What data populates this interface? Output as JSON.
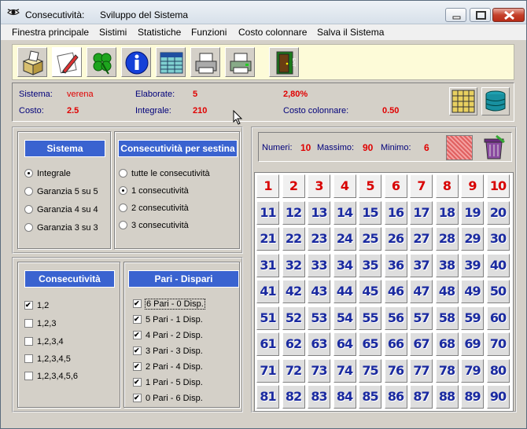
{
  "window": {
    "app_title": "Consecutività:",
    "doc_title": "Sviluppo del Sistema"
  },
  "menu": [
    "Finestra principale",
    "Sistimi",
    "Statistiche",
    "Funzioni",
    "Costo colonnare",
    "Salva il Sistema"
  ],
  "toolbar": [
    "open-box-icon",
    "edit-pen-icon",
    "clover-icon",
    "info-icon",
    "table-sheet-icon",
    "printer-icon",
    "printer-color-icon",
    "exit-door-icon"
  ],
  "info": {
    "sistema_label": "Sistema:",
    "sistema_value": "verena",
    "costo_label": "Costo:",
    "costo_value": "2.5",
    "elaborate_label": "Elaborate:",
    "elaborate_value": "5",
    "integrale_label": "Integrale:",
    "integrale_value": "210",
    "percent_value": "2,80%",
    "colonnare_label": "Costo colonnare:",
    "colonnare_value": "0.50"
  },
  "sistema": {
    "title": "Sistema",
    "options": [
      "Integrale",
      "Garanzia 5 su 5",
      "Garanzia 4 su 4",
      "Garanzia 3 su 3"
    ],
    "selected": 0
  },
  "consec_sestina": {
    "title": "Consecutività per sestina",
    "options": [
      "tutte le consecutività",
      "1  consecutività",
      "2 consecutività",
      "3 consecutività"
    ],
    "selected": 1
  },
  "consecutivita": {
    "title": "Consecutività",
    "options": [
      {
        "label": "1,2",
        "checked": true
      },
      {
        "label": "1,2,3",
        "checked": false
      },
      {
        "label": "1,2,3,4",
        "checked": false
      },
      {
        "label": "1,2,3,4,5",
        "checked": false
      },
      {
        "label": "1,2,3,4,5,6",
        "checked": false
      }
    ]
  },
  "pari_dispari": {
    "title": "Pari - Dispari",
    "options": [
      {
        "label": "6 Pari - 0 Disp.",
        "checked": true
      },
      {
        "label": "5 Pari - 1 Disp.",
        "checked": true
      },
      {
        "label": "4 Pari - 2 Disp.",
        "checked": true
      },
      {
        "label": "3 Pari - 3 Disp.",
        "checked": true
      },
      {
        "label": "2 Pari - 4 Disp.",
        "checked": true
      },
      {
        "label": "1 Pari - 5 Disp.",
        "checked": true
      },
      {
        "label": "0 Pari - 6 Disp.",
        "checked": true
      }
    ]
  },
  "stats": {
    "numeri_label": "Numeri:",
    "numeri_value": "10",
    "massimo_label": "Massimo:",
    "massimo_value": "90",
    "minimo_label": "Minimo:",
    "minimo_value": "6"
  },
  "colors": {
    "group_title_bg": "#3a63d0",
    "value_red": "#e00000",
    "label_blue": "#00007a",
    "number_blue": "#1a2aa0",
    "number_red": "#d80000",
    "toolbar_bg": "#fdfbd8"
  }
}
